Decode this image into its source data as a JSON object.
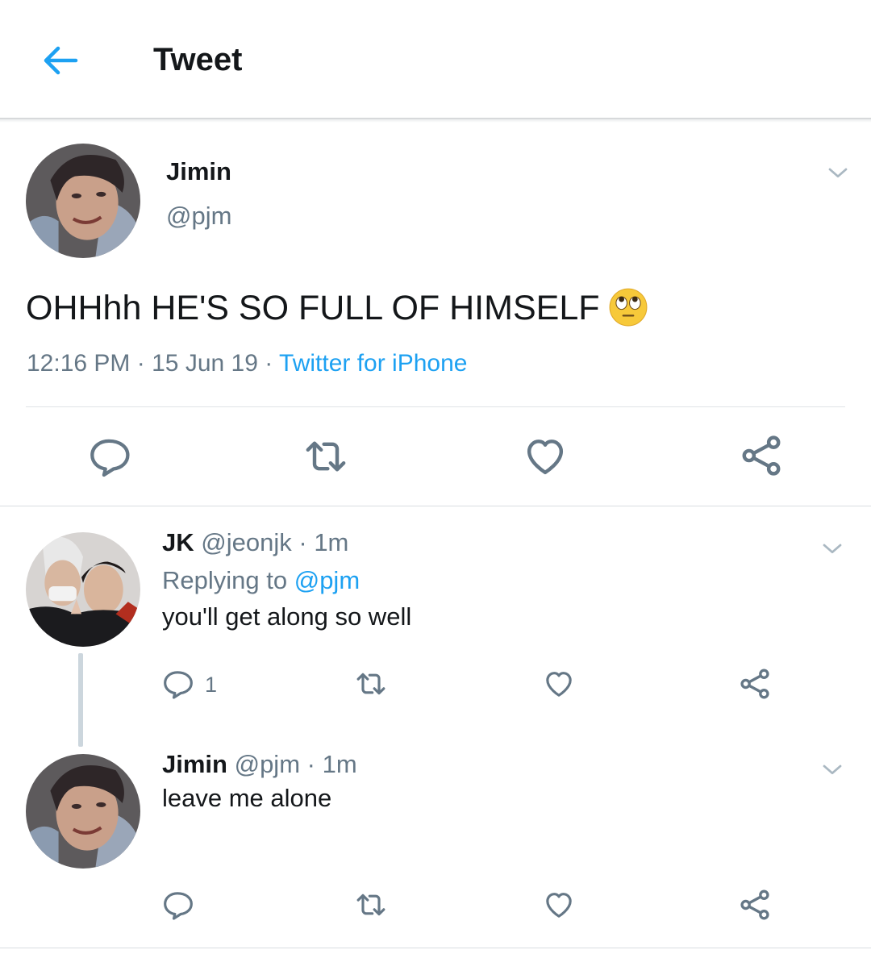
{
  "header": {
    "title": "Tweet"
  },
  "main_tweet": {
    "name": "Jimin",
    "handle": "@pjm",
    "text": "OHHhh HE'S SO FULL OF HIMSELF",
    "time": "12:16 PM",
    "sep1": "·",
    "date": "15 Jun 19",
    "sep2": "·",
    "source": "Twitter for iPhone"
  },
  "replies": [
    {
      "name": "JK",
      "handle": "@jeonjk",
      "sep": "·",
      "age": "1m",
      "replying_prefix": "Replying to",
      "replying_to": "@pjm",
      "text": "you'll get along so well",
      "reply_count": "1"
    },
    {
      "name": "Jimin",
      "handle": "@pjm",
      "sep": "·",
      "age": "1m",
      "text": "leave me alone"
    }
  ],
  "icons": {
    "back": "arrow-left-icon",
    "menu": "chevron-down-icon",
    "reply": "reply-icon",
    "retweet": "retweet-icon",
    "like": "heart-icon",
    "share": "share-icon",
    "emoji": "face-with-rolling-eyes"
  },
  "colors": {
    "accent": "#1da1f2",
    "text": "#14171a",
    "muted": "#657786",
    "icon": "#657786",
    "divider": "#dfe3e6"
  }
}
